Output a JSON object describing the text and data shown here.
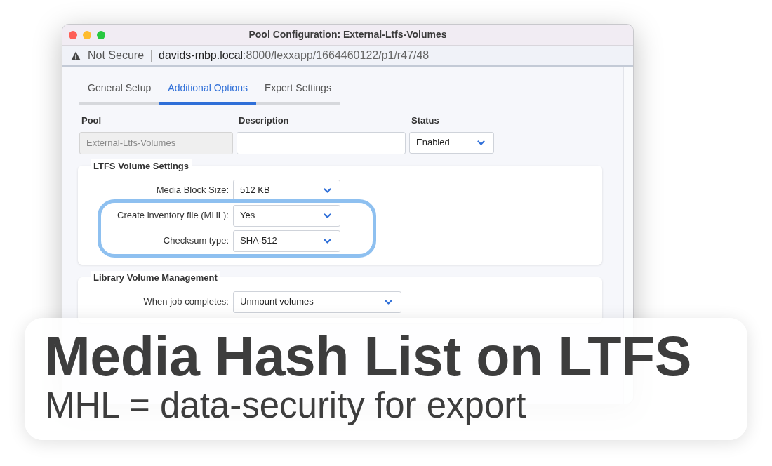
{
  "window": {
    "title": "Pool Configuration: External-Ltfs-Volumes"
  },
  "address_bar": {
    "security": "Not Secure",
    "host": "davids-mbp.local",
    "path": ":8000/lexxapp/1664460122/p1/r47/48"
  },
  "tabs": [
    {
      "label": "General Setup",
      "selected": false
    },
    {
      "label": "Additional Options",
      "selected": true
    },
    {
      "label": "Expert Settings",
      "selected": false
    }
  ],
  "fields": [
    {
      "label": "Pool",
      "kind": "text",
      "value": "External-Ltfs-Volumes",
      "disabled": true
    },
    {
      "label": "Description",
      "kind": "text",
      "disabled": false
    },
    {
      "label": "Status",
      "kind": "select",
      "value": "Enabled"
    }
  ],
  "sections": [
    {
      "title": "LTFS Volume Settings",
      "rows": [
        {
          "label": "Media Block Size:",
          "value": "512 KB",
          "highlighted": false
        },
        {
          "label": "Create inventory file (MHL):",
          "value": "Yes",
          "highlighted": true
        },
        {
          "label": "Checksum type:",
          "value": "SHA-512",
          "highlighted": true
        }
      ]
    },
    {
      "title": "Library Volume Management",
      "rows": [
        {
          "label": "When job completes:",
          "value": "Unmount volumes",
          "highlighted": false
        }
      ]
    }
  ],
  "banner": {
    "headline": "Media Hash List on LTFS",
    "subtitle": "MHL = data-security for export"
  }
}
